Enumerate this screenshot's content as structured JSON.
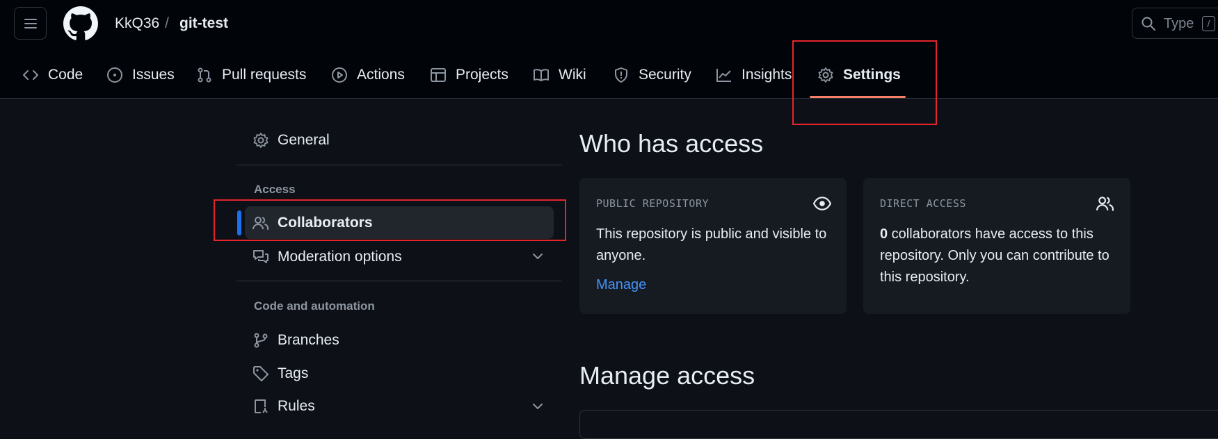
{
  "header": {
    "owner": "KkQ36",
    "separator": "/",
    "repo": "git-test",
    "search_placeholder": "Type",
    "search_key": "/"
  },
  "tabs": [
    {
      "label": "Code",
      "icon": "code-icon"
    },
    {
      "label": "Issues",
      "icon": "issue-opened-icon"
    },
    {
      "label": "Pull requests",
      "icon": "git-pull-request-icon"
    },
    {
      "label": "Actions",
      "icon": "play-icon"
    },
    {
      "label": "Projects",
      "icon": "table-icon"
    },
    {
      "label": "Wiki",
      "icon": "book-icon"
    },
    {
      "label": "Security",
      "icon": "shield-icon"
    },
    {
      "label": "Insights",
      "icon": "graph-icon"
    },
    {
      "label": "Settings",
      "icon": "gear-icon",
      "active": true
    }
  ],
  "sidebar": {
    "general": "General",
    "access_heading": "Access",
    "collaborators": "Collaborators",
    "moderation": "Moderation options",
    "code_automation_heading": "Code and automation",
    "branches": "Branches",
    "tags": "Tags",
    "rules": "Rules"
  },
  "main": {
    "who_has_access": "Who has access",
    "public_card": {
      "label": "PUBLIC REPOSITORY",
      "text": "This repository is public and visible to anyone.",
      "link": "Manage"
    },
    "direct_card": {
      "label": "DIRECT ACCESS",
      "count": "0",
      "text": " collaborators have access to this repository. Only you can contribute to this repository."
    },
    "manage_access": "Manage access"
  },
  "colors": {
    "background": "#0d1117",
    "header_bg": "#010409",
    "accent_underline": "#f78166",
    "selected_bar": "#1f6feb",
    "link": "#4493f8",
    "highlight_box": "#e4252b"
  }
}
